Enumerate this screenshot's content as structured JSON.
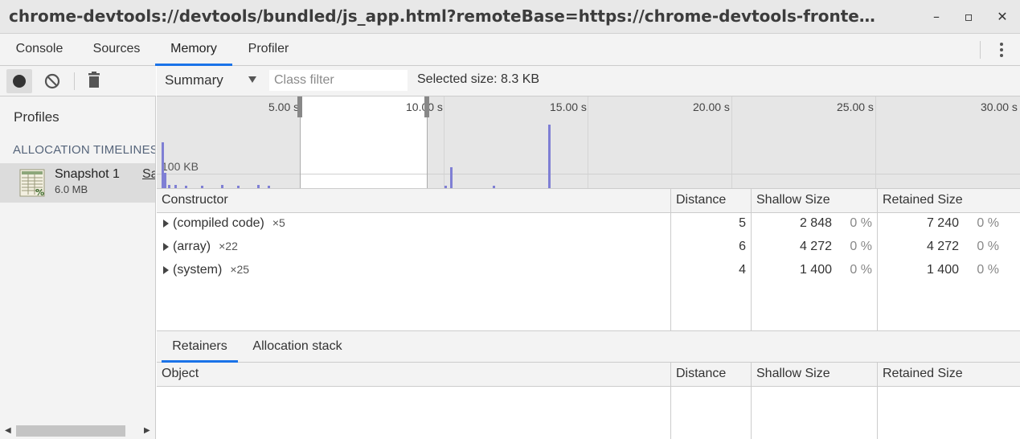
{
  "window": {
    "title": "chrome-devtools://devtools/bundled/js_app.html?remoteBase=https://chrome-devtools-fronte…",
    "minimize": "–",
    "maximize": "▫",
    "close": "✕"
  },
  "tabs": [
    {
      "label": "Console",
      "active": false
    },
    {
      "label": "Sources",
      "active": false
    },
    {
      "label": "Memory",
      "active": true
    },
    {
      "label": "Profiler",
      "active": false
    }
  ],
  "toolbar": {
    "view_select": "Summary",
    "class_filter_placeholder": "Class filter",
    "selected_size": "Selected size: 8.3 KB"
  },
  "sidebar": {
    "profiles_heading": "Profiles",
    "section_heading": "ALLOCATION TIMELINES",
    "snapshot": {
      "name": "Snapshot 1",
      "size": "6.0 MB",
      "save_link": "Save"
    }
  },
  "timeline": {
    "ticks": [
      "5.00 s",
      "10.00 s",
      "15.00 s",
      "20.00 s",
      "25.00 s",
      "30.00 s"
    ],
    "scale_label": "100 KB",
    "selection_range_s": [
      5.0,
      10.0
    ]
  },
  "constructor_table": {
    "columns": [
      "Constructor",
      "Distance",
      "Shallow Size",
      "Retained Size"
    ],
    "rows": [
      {
        "name": "(compiled code)",
        "count": "×5",
        "distance": "5",
        "shallow": "2 848",
        "shallow_pct": "0 %",
        "retained": "7 240",
        "retained_pct": "0 %"
      },
      {
        "name": "(array)",
        "count": "×22",
        "distance": "6",
        "shallow": "4 272",
        "shallow_pct": "0 %",
        "retained": "4 272",
        "retained_pct": "0 %"
      },
      {
        "name": "(system)",
        "count": "×25",
        "distance": "4",
        "shallow": "1 400",
        "shallow_pct": "0 %",
        "retained": "1 400",
        "retained_pct": "0 %"
      }
    ]
  },
  "bottom_tabs": [
    {
      "label": "Retainers",
      "active": true
    },
    {
      "label": "Allocation stack",
      "active": false
    }
  ],
  "retainers_table": {
    "columns": [
      "Object",
      "Distance",
      "Shallow Size",
      "Retained Size"
    ]
  },
  "colors": {
    "accent": "#1a73e8",
    "allocation_bar": "#7f7fd4"
  }
}
